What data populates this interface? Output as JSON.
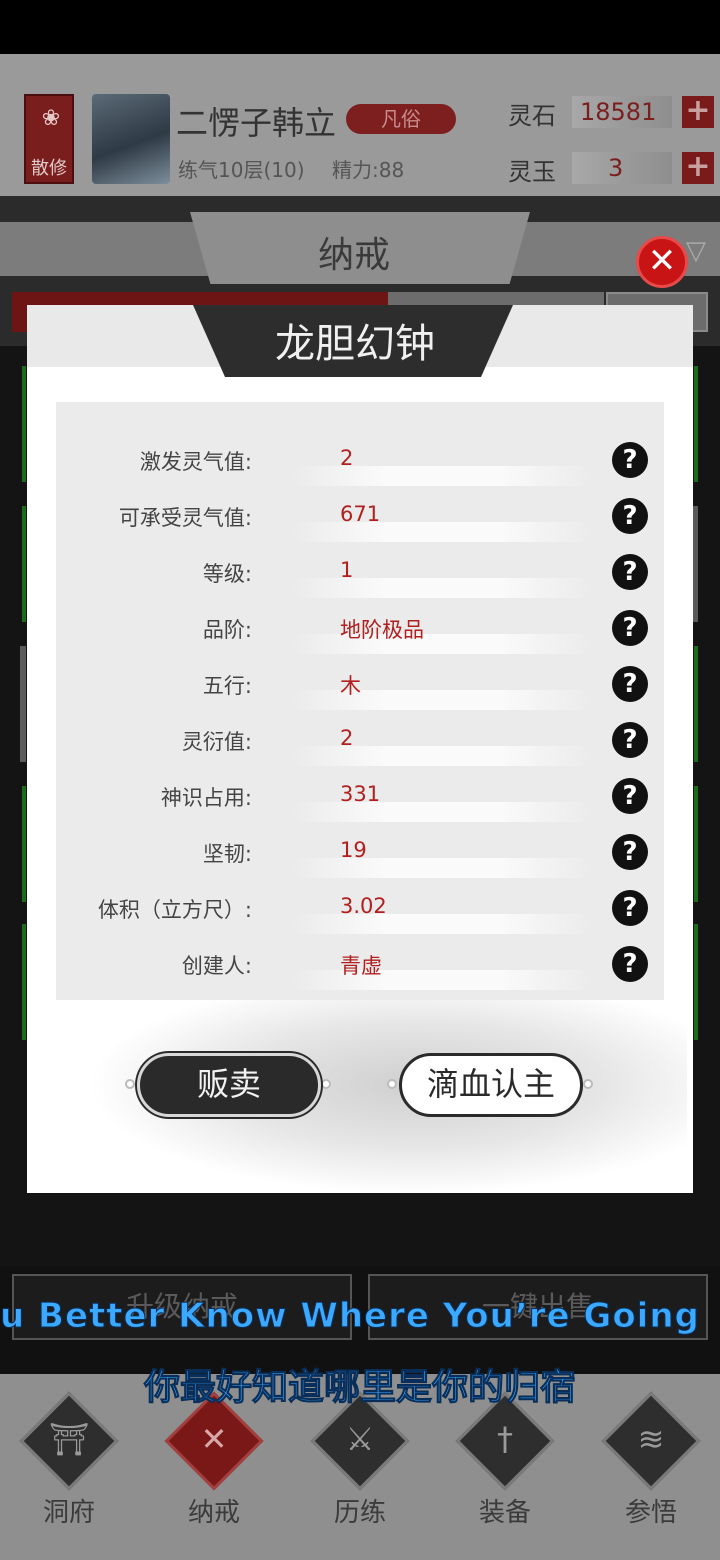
{
  "header": {
    "sect_label": "散修",
    "player_name": "二愣子韩立",
    "rank": "凡俗",
    "realm": "练气10层(10)",
    "energy": "精力:88",
    "currencies": [
      {
        "label": "灵石",
        "value": "18581"
      },
      {
        "label": "灵玉",
        "value": "3"
      }
    ],
    "plus_symbol": "+"
  },
  "inventory": {
    "title": "纳戒",
    "filter_icon": "filter-icon"
  },
  "modal": {
    "title": "龙胆幻钟",
    "close_symbol": "✕",
    "help_symbol": "?",
    "stats": [
      {
        "label": "激发灵气值:",
        "value": "2"
      },
      {
        "label": "可承受灵气值:",
        "value": "671"
      },
      {
        "label": "等级:",
        "value": "1"
      },
      {
        "label": "品阶:",
        "value": "地阶极品"
      },
      {
        "label": "五行:",
        "value": "木"
      },
      {
        "label": "灵衍值:",
        "value": "2"
      },
      {
        "label": "神识占用:",
        "value": "331"
      },
      {
        "label": "坚韧:",
        "value": "19"
      },
      {
        "label": "体积（立方尺）:",
        "value": "3.02"
      },
      {
        "label": "创建人:",
        "value": "青虚"
      }
    ],
    "sell_label": "贩卖",
    "bind_label": "滴血认主"
  },
  "actions": {
    "upgrade_label": "升级纳戒",
    "sell_all_label": "一键出售"
  },
  "subtitles": {
    "english": "u Better Know Where You’re Going",
    "chinese": "你最好知道哪里是你的归宿"
  },
  "nav": [
    {
      "label": "洞府",
      "icon": "pavilion-icon",
      "glyph": "⛩"
    },
    {
      "label": "纳戒",
      "icon": "cross-icon",
      "glyph": "✕"
    },
    {
      "label": "历练",
      "icon": "crossed-swords-icon",
      "glyph": "⚔"
    },
    {
      "label": "装备",
      "icon": "sword-icon",
      "glyph": "†"
    },
    {
      "label": "参悟",
      "icon": "book-icon",
      "glyph": "≋"
    }
  ],
  "colors": {
    "accent_red": "#b21f1f",
    "subtitle_blue": "#3aa9ff"
  }
}
